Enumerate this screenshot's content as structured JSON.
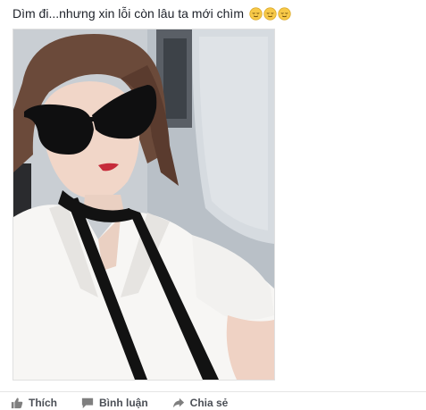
{
  "post": {
    "text": "Dìm đi...nhưng xin lỗi còn lâu ta mới chìm",
    "emojis": [
      "relieved-face-emoji",
      "relieved-face-emoji",
      "relieved-face-emoji"
    ]
  },
  "photo": {
    "icon": "photo",
    "colors": {
      "shirt": "#f7f6f4",
      "hair": "#6b4a3a",
      "seat": "#d4d9de",
      "strap": "#121212"
    }
  },
  "actions": [
    {
      "label": "Thích",
      "icon": "thumbs-up-icon"
    },
    {
      "label": "Bình luận",
      "icon": "comment-icon"
    },
    {
      "label": "Chia sẻ",
      "icon": "share-icon"
    }
  ]
}
